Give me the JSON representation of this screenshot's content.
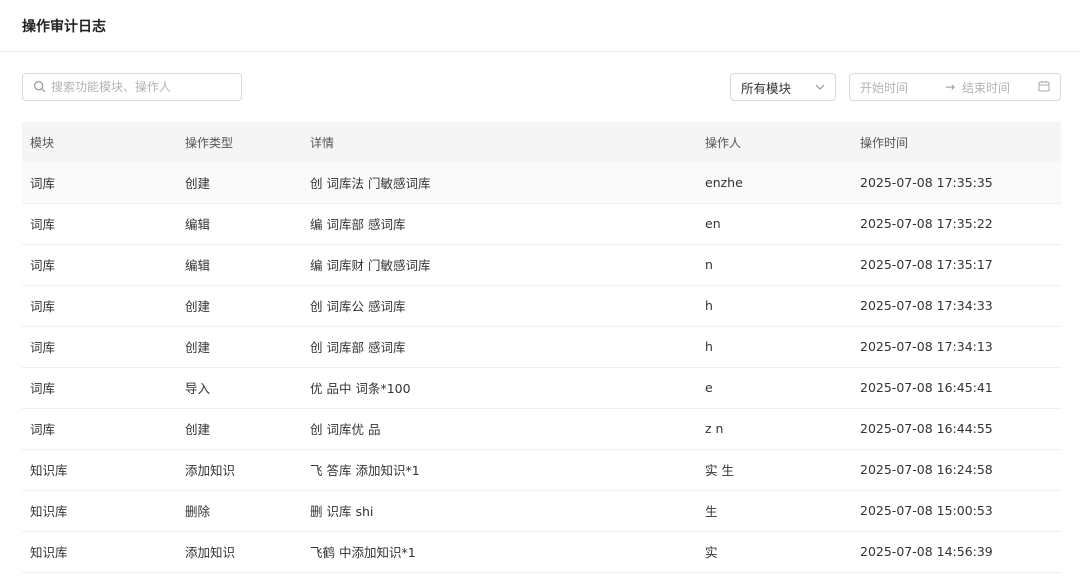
{
  "header": {
    "title": "操作审计日志"
  },
  "filters": {
    "search_placeholder": "搜索功能模块、操作人",
    "module_select_value": "所有模块",
    "date_start_placeholder": "开始时间",
    "date_arrow": "→",
    "date_end_placeholder": "结束时间"
  },
  "table": {
    "columns": [
      "模块",
      "操作类型",
      "详情",
      "操作人",
      "操作时间"
    ],
    "rows": [
      {
        "module": "词库",
        "type": "创建",
        "detail": "创 词库法 门敏感词库",
        "operator": "enzhe",
        "time": "2025-07-08 17:35:35"
      },
      {
        "module": "词库",
        "type": "编辑",
        "detail": "编 词库部 感词库",
        "operator": "en",
        "time": "2025-07-08 17:35:22"
      },
      {
        "module": "词库",
        "type": "编辑",
        "detail": "编 词库财 门敏感词库",
        "operator": "n",
        "time": "2025-07-08 17:35:17"
      },
      {
        "module": "词库",
        "type": "创建",
        "detail": "创 词库公 感词库",
        "operator": "h",
        "time": "2025-07-08 17:34:33"
      },
      {
        "module": "词库",
        "type": "创建",
        "detail": "创 词库部 感词库",
        "operator": "h",
        "time": "2025-07-08 17:34:13"
      },
      {
        "module": "词库",
        "type": "导入",
        "detail": "优 品中 词条*100",
        "operator": "e",
        "time": "2025-07-08 16:45:41"
      },
      {
        "module": "词库",
        "type": "创建",
        "detail": "创 词库优 品",
        "operator": "z n",
        "time": "2025-07-08 16:44:55"
      },
      {
        "module": "知识库",
        "type": "添加知识",
        "detail": "飞 答库 添加知识*1",
        "operator": "实 生",
        "time": "2025-07-08 16:24:58"
      },
      {
        "module": "知识库",
        "type": "删除",
        "detail": "删 识库 shi",
        "operator": "生",
        "time": "2025-07-08 15:00:53"
      },
      {
        "module": "知识库",
        "type": "添加知识",
        "detail": "飞鹤 中添加知识*1",
        "operator": "实",
        "time": "2025-07-08 14:56:39"
      }
    ]
  },
  "icons": {
    "search": "search-icon",
    "dropdown": "chevron-down-icon",
    "calendar": "calendar-icon"
  }
}
